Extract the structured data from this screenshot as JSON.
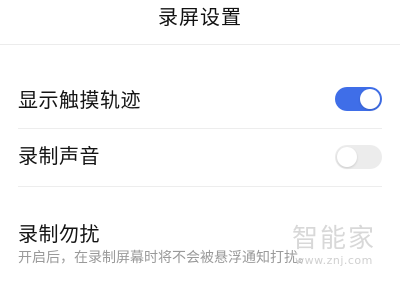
{
  "header": {
    "title": "录屏设置"
  },
  "settings": [
    {
      "label": "显示触摸轨迹",
      "enabled": true
    },
    {
      "label": "录制声音",
      "enabled": false
    },
    {
      "label": "录制勿扰",
      "description": "开启后，在录制屏幕时将不会被悬浮通知打扰。"
    }
  ],
  "watermark": {
    "logo_text": "智能家",
    "url": "www.znj.com"
  },
  "colors": {
    "toggle_on": "#3f6ee8",
    "toggle_off": "#ececec",
    "text_primary": "#141414",
    "text_secondary": "#9a9a9a"
  }
}
